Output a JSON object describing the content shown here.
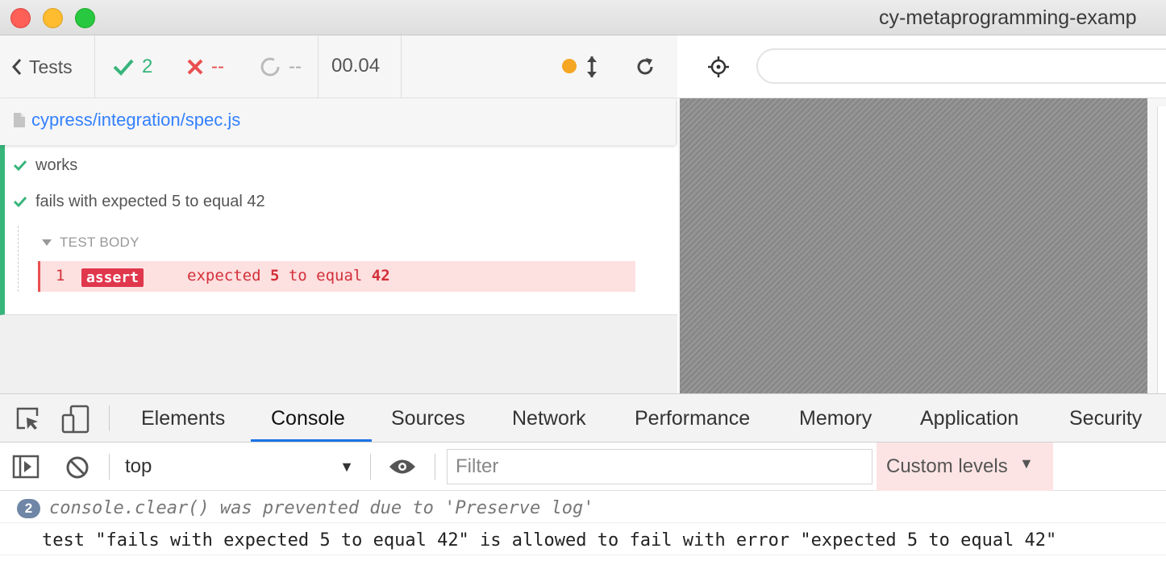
{
  "window": {
    "title": "cy-metaprogramming-examp"
  },
  "reporter": {
    "back_label": "Tests",
    "stats": {
      "passed": "2",
      "failed": "--",
      "pending": "--"
    },
    "duration": "00.04",
    "spec_file": "cypress/integration/spec.js",
    "tests": [
      {
        "title": "works",
        "state": "passed"
      },
      {
        "title": "fails with expected 5 to equal 42",
        "state": "passed"
      }
    ],
    "test_body_label": "TEST BODY",
    "command": {
      "number": "1",
      "name": "assert",
      "msg_prefix": "expected ",
      "msg_value1": "5",
      "msg_middle": " to equal ",
      "msg_value2": "42"
    }
  },
  "devtools": {
    "tabs": [
      "Elements",
      "Console",
      "Sources",
      "Network",
      "Performance",
      "Memory",
      "Application",
      "Security"
    ],
    "active_tab": "Console",
    "context": "top",
    "filter_placeholder": "Filter",
    "levels_label": "Custom levels",
    "messages": [
      {
        "count": "2",
        "text": "console.clear() was prevented due to 'Preserve log'"
      },
      {
        "text": "test \"fails with expected 5 to equal 42\" is allowed to fail with error \"expected 5 to equal 42\""
      }
    ]
  },
  "colors": {
    "passed": "#37b57a",
    "failed": "#e94f4f",
    "link": "#3380ff",
    "devtools_accent": "#1a73e8"
  }
}
